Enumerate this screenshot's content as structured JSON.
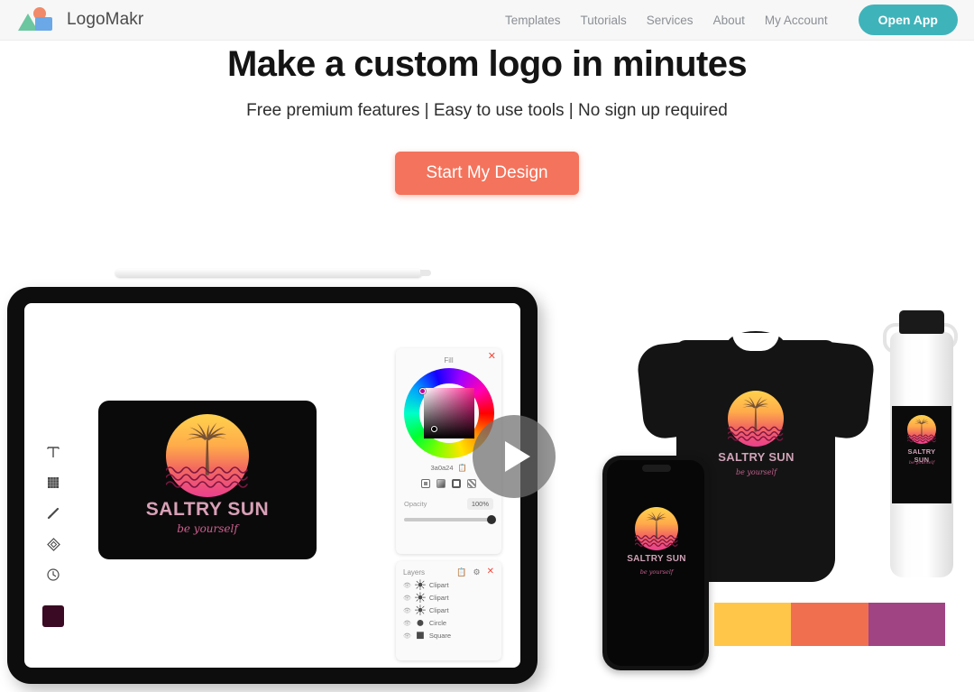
{
  "header": {
    "brand_name": "LogoMakr",
    "nav_items": [
      {
        "label": "Templates"
      },
      {
        "label": "Tutorials"
      },
      {
        "label": "Services"
      },
      {
        "label": "About"
      },
      {
        "label": "My Account"
      }
    ],
    "cta_label": "Open App"
  },
  "hero": {
    "headline": "Make a custom logo in minutes",
    "subheadline": "Free premium features | Easy to use tools | No sign up required",
    "cta_label": "Start My Design"
  },
  "editor": {
    "fill_panel": {
      "title": "Fill",
      "hex_value": "3a0a24",
      "opacity_label": "Opacity",
      "opacity_value": "100%"
    },
    "layers_panel": {
      "title": "Layers",
      "items": [
        {
          "name": "Clipart"
        },
        {
          "name": "Clipart"
        },
        {
          "name": "Clipart"
        },
        {
          "name": "Circle"
        },
        {
          "name": "Square"
        }
      ]
    },
    "tools": [
      {
        "icon": "text-tool-icon"
      },
      {
        "icon": "shape-tool-icon"
      },
      {
        "icon": "pen-tool-icon"
      },
      {
        "icon": "diamond-tool-icon"
      },
      {
        "icon": "history-tool-icon"
      }
    ],
    "active_color": "#3a0a24"
  },
  "logo": {
    "name": "SALTRY SUN",
    "tagline": "be yourself"
  },
  "palette": {
    "colors": [
      "#ffc64a",
      "#ef6f4f",
      "#a04484"
    ]
  },
  "colors": {
    "accent_teal": "#3fb3ba",
    "accent_coral": "#f4735c",
    "header_bg": "#f7f7f7"
  }
}
